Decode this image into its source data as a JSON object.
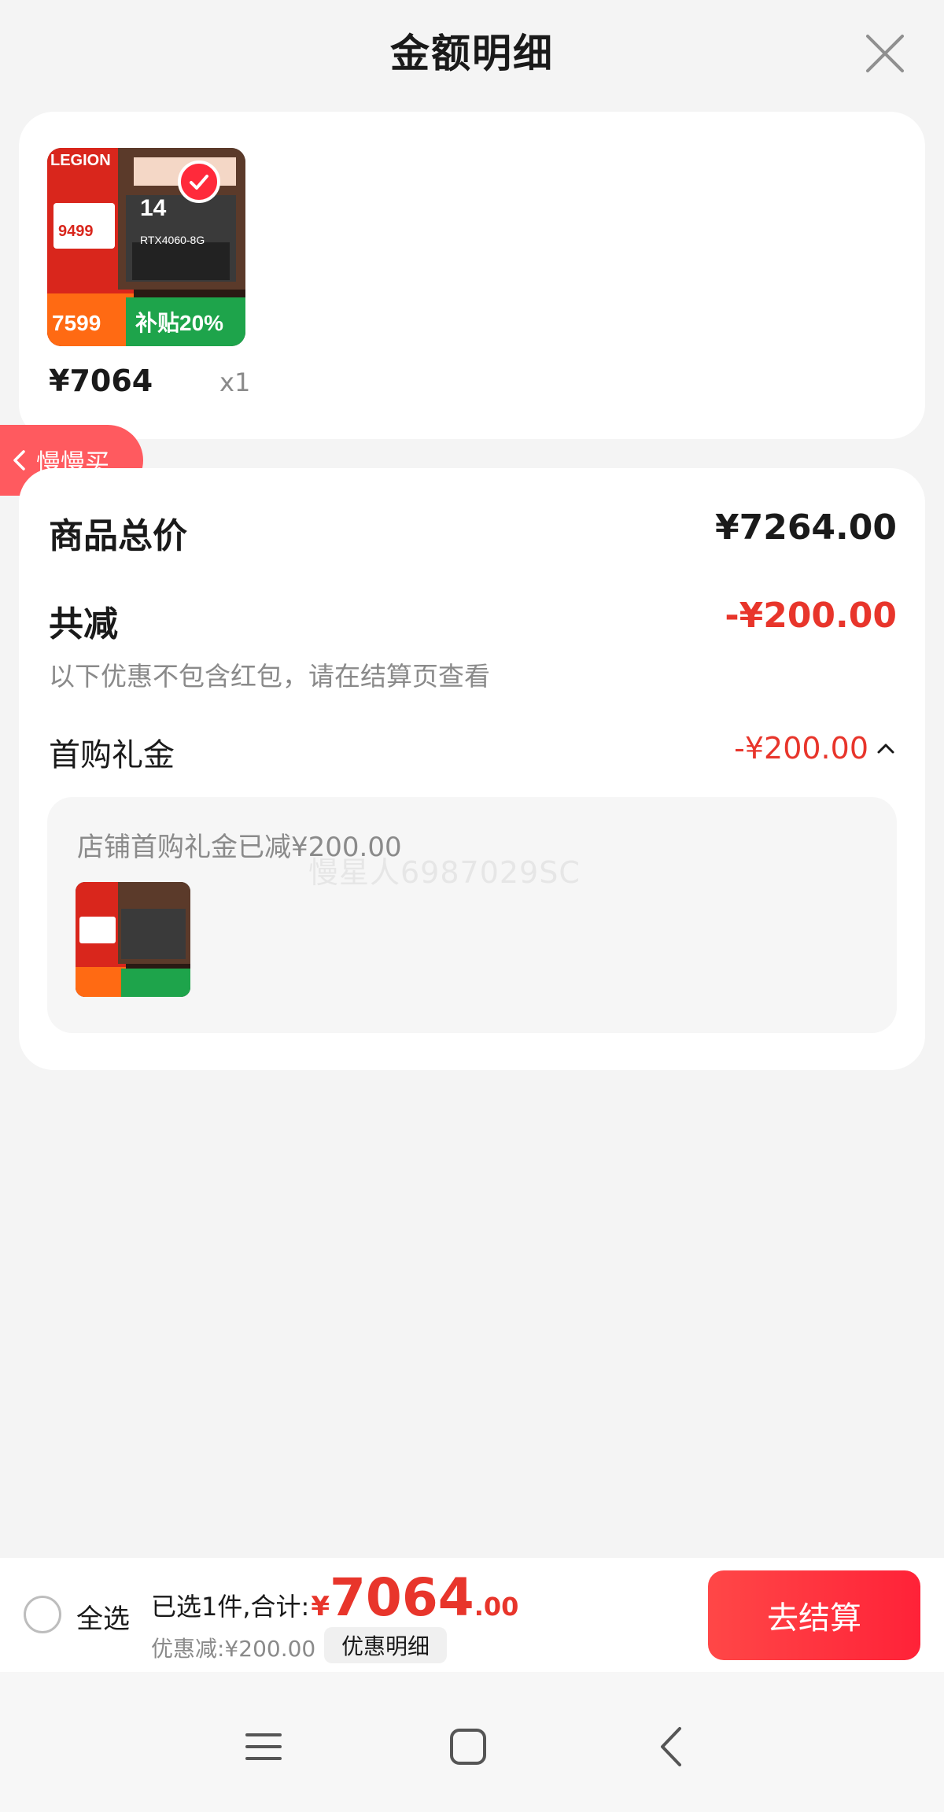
{
  "header": {
    "title": "金额明细"
  },
  "product": {
    "price": "¥7064",
    "quantity": "x1"
  },
  "thumbnail": {
    "brand": "LEGION",
    "tag": "14",
    "gpu": "RTX4060-8G",
    "promo_price": "9499",
    "final_price": "7599",
    "subsidy": "补贴20%"
  },
  "slow_buy": {
    "label": "慢慢买"
  },
  "summary": {
    "total_label": "商品总价",
    "total_value": "¥7264.00",
    "reduce_label": "共减",
    "reduce_value": "-¥200.00",
    "reduce_hint": "以下优惠不包含红包，请在结算页查看",
    "gift_label": "首购礼金",
    "gift_value": "-¥200.00",
    "detail_text": "店铺首购礼金已减¥200.00"
  },
  "watermark": "慢星人6987029SC",
  "footer": {
    "select_all": "全选",
    "selected_text": "已选1件,合计:",
    "currency": "¥",
    "total_int": "7064",
    "total_dec": ".00",
    "discount_text": "优惠减:¥200.00",
    "detail_button": "优惠明细",
    "checkout_button": "去结算"
  },
  "colors": {
    "accent_red": "#e8352b",
    "button_red": "#ff2a3b",
    "background": "#f4f4f4"
  },
  "icons": [
    "close-icon",
    "check-icon",
    "chevron-left-icon",
    "chevron-up-icon",
    "menu-icon",
    "home-icon",
    "back-icon"
  ]
}
